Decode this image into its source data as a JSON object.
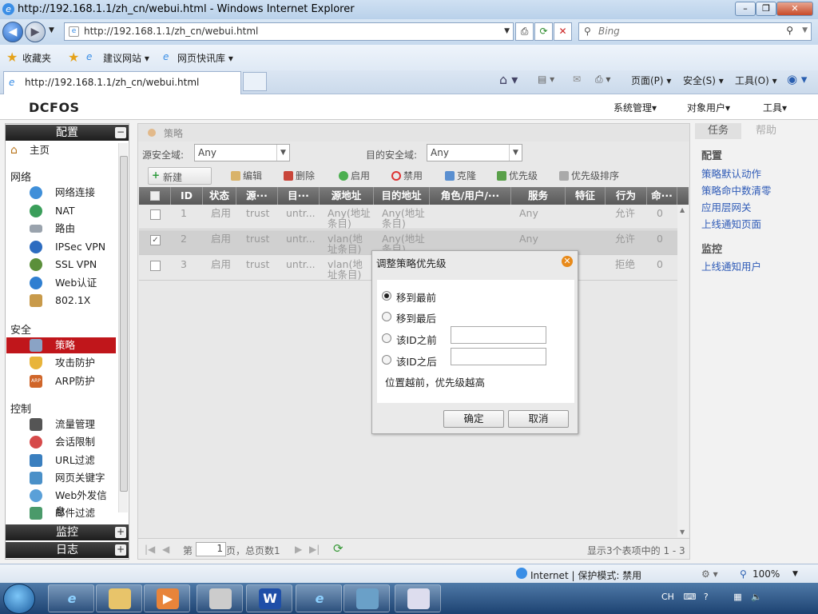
{
  "browser": {
    "window_title": "http://192.168.1.1/zh_cn/webui.html - Windows Internet Explorer",
    "address": "http://192.168.1.1/zh_cn/webui.html",
    "search_placeholder": "Bing",
    "favorites": "收藏夹",
    "fav_links": [
      "建议网站 ▾",
      "网页快讯库 ▾"
    ],
    "tab_title": "http://192.168.1.1/zh_cn/webui.html",
    "commands": [
      "页面(P) ▾",
      "安全(S) ▾",
      "工具(O) ▾"
    ],
    "status_zone": "Internet | 保护模式: 禁用",
    "zoom": "100%"
  },
  "app": {
    "logo": "DCFOS",
    "top_menu": [
      "系统管理▾",
      "对象用户▾",
      "工具▾"
    ]
  },
  "sidebar": {
    "config_header": "配置",
    "home": "主页",
    "groups": {
      "network": "网络",
      "security": "安全",
      "control": "控制"
    },
    "network_items": [
      "网络连接",
      "NAT",
      "路由",
      "IPSec VPN",
      "SSL VPN",
      "Web认证",
      "802.1X"
    ],
    "security_items": [
      "策略",
      "攻击防护",
      "ARP防护"
    ],
    "control_items": [
      "流量管理",
      "会话限制",
      "URL过滤",
      "网页关键字",
      "Web外发信息",
      "邮件过滤"
    ],
    "monitor_header": "监控",
    "log_header": "日志",
    "plus": "+",
    "minus": "−"
  },
  "main": {
    "breadcrumb": "策略",
    "src_zone_label": "源安全域:",
    "src_zone_value": "Any",
    "dst_zone_label": "目的安全域:",
    "dst_zone_value": "Any",
    "toolbar": [
      "新建",
      "编辑",
      "删除",
      "启用",
      "禁用",
      "克隆",
      "优先级",
      "优先级排序"
    ],
    "columns": [
      "ID",
      "状态",
      "源···",
      "目···",
      "源地址",
      "目的地址",
      "角色/用户/···",
      "服务",
      "特征",
      "行为",
      "命···"
    ],
    "rows": [
      {
        "id": "1",
        "status": "启用",
        "src": "trust",
        "dst": "untr...",
        "src_addr": [
          "Any(地址",
          "条目)"
        ],
        "dst_addr": [
          "Any(地址",
          "条目)"
        ],
        "service": "Any",
        "action": "允许",
        "hits": "0",
        "checked": false
      },
      {
        "id": "2",
        "status": "启用",
        "src": "trust",
        "dst": "untr...",
        "src_addr": [
          "vlan(地",
          "址条目)"
        ],
        "dst_addr": [
          "Any(地址",
          "条目)"
        ],
        "service": "Any",
        "action": "允许",
        "hits": "0",
        "checked": true
      },
      {
        "id": "3",
        "status": "启用",
        "src": "trust",
        "dst": "untr...",
        "src_addr": [
          "vlan(地",
          "址条目)"
        ],
        "dst_addr": [
          "",
          ""
        ],
        "service": "",
        "action": "拒绝",
        "hits": "0",
        "checked": false
      }
    ],
    "pager": {
      "page_prefix": "第",
      "page_value": "1",
      "page_suffix": "页，总页数1",
      "summary": "显示3个表项中的 1 - 3"
    }
  },
  "right_panel": {
    "tab_task": "任务",
    "tab_help": "帮助",
    "config_head": "配置",
    "config_links": [
      "策略默认动作",
      "策略命中数清零",
      "应用层网关",
      "上线通知页面"
    ],
    "monitor_head": "监控",
    "monitor_links": [
      "上线通知用户"
    ]
  },
  "modal": {
    "title": "调整策略优先级",
    "options": [
      "移到最前",
      "移到最后",
      "该ID之前",
      "该ID之后"
    ],
    "selected_option": "移到最前",
    "hint": "位置越前，优先级越高",
    "ok": "确定",
    "cancel": "取消"
  },
  "taskbar": {
    "tray_lang": "CH"
  },
  "colors": {
    "selected_item": "#c0161b",
    "link": "#2f5bb7",
    "grid_header": "#666666",
    "close_icon": "#e88a1a"
  }
}
